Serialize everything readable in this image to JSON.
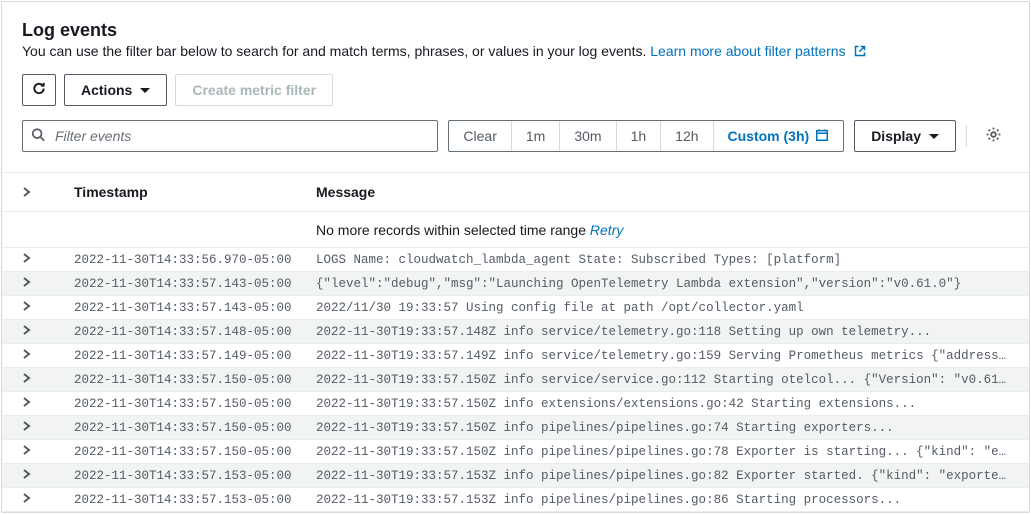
{
  "header": {
    "title": "Log events",
    "description": "You can use the filter bar below to search for and match terms, phrases, or values in your log events. ",
    "learn_more": "Learn more about filter patterns"
  },
  "toolbar": {
    "actions_label": "Actions",
    "create_metric_filter_label": "Create metric filter"
  },
  "filter": {
    "search_placeholder": "Filter events",
    "clear": "Clear",
    "ranges": [
      "1m",
      "30m",
      "1h",
      "12h"
    ],
    "custom_label": "Custom (3h)",
    "display_label": "Display"
  },
  "table": {
    "col_timestamp": "Timestamp",
    "col_message": "Message",
    "info_msg": "No more records within selected time range ",
    "retry_label": "Retry"
  },
  "rows": [
    {
      "ts": "2022-11-30T14:33:56.970-05:00",
      "msg": "LOGS Name: cloudwatch_lambda_agent State: Subscribed Types: [platform]"
    },
    {
      "ts": "2022-11-30T14:33:57.143-05:00",
      "msg": "{\"level\":\"debug\",\"msg\":\"Launching OpenTelemetry Lambda extension\",\"version\":\"v0.61.0\"}"
    },
    {
      "ts": "2022-11-30T14:33:57.143-05:00",
      "msg": "2022/11/30 19:33:57 Using config file at path /opt/collector.yaml"
    },
    {
      "ts": "2022-11-30T14:33:57.148-05:00",
      "msg": "2022-11-30T19:33:57.148Z info service/telemetry.go:118 Setting up own telemetry..."
    },
    {
      "ts": "2022-11-30T14:33:57.149-05:00",
      "msg": "2022-11-30T19:33:57.149Z info service/telemetry.go:159 Serving Prometheus metrics {\"address…"
    },
    {
      "ts": "2022-11-30T14:33:57.150-05:00",
      "msg": "2022-11-30T19:33:57.150Z info service/service.go:112 Starting otelcol... {\"Version\": \"v0.61…"
    },
    {
      "ts": "2022-11-30T14:33:57.150-05:00",
      "msg": "2022-11-30T19:33:57.150Z info extensions/extensions.go:42 Starting extensions..."
    },
    {
      "ts": "2022-11-30T14:33:57.150-05:00",
      "msg": "2022-11-30T19:33:57.150Z info pipelines/pipelines.go:74 Starting exporters..."
    },
    {
      "ts": "2022-11-30T14:33:57.150-05:00",
      "msg": "2022-11-30T19:33:57.150Z info pipelines/pipelines.go:78 Exporter is starting... {\"kind\": \"e…"
    },
    {
      "ts": "2022-11-30T14:33:57.153-05:00",
      "msg": "2022-11-30T19:33:57.153Z info pipelines/pipelines.go:82 Exporter started. {\"kind\": \"exporte…"
    },
    {
      "ts": "2022-11-30T14:33:57.153-05:00",
      "msg": "2022-11-30T19:33:57.153Z info pipelines/pipelines.go:86 Starting processors..."
    }
  ]
}
